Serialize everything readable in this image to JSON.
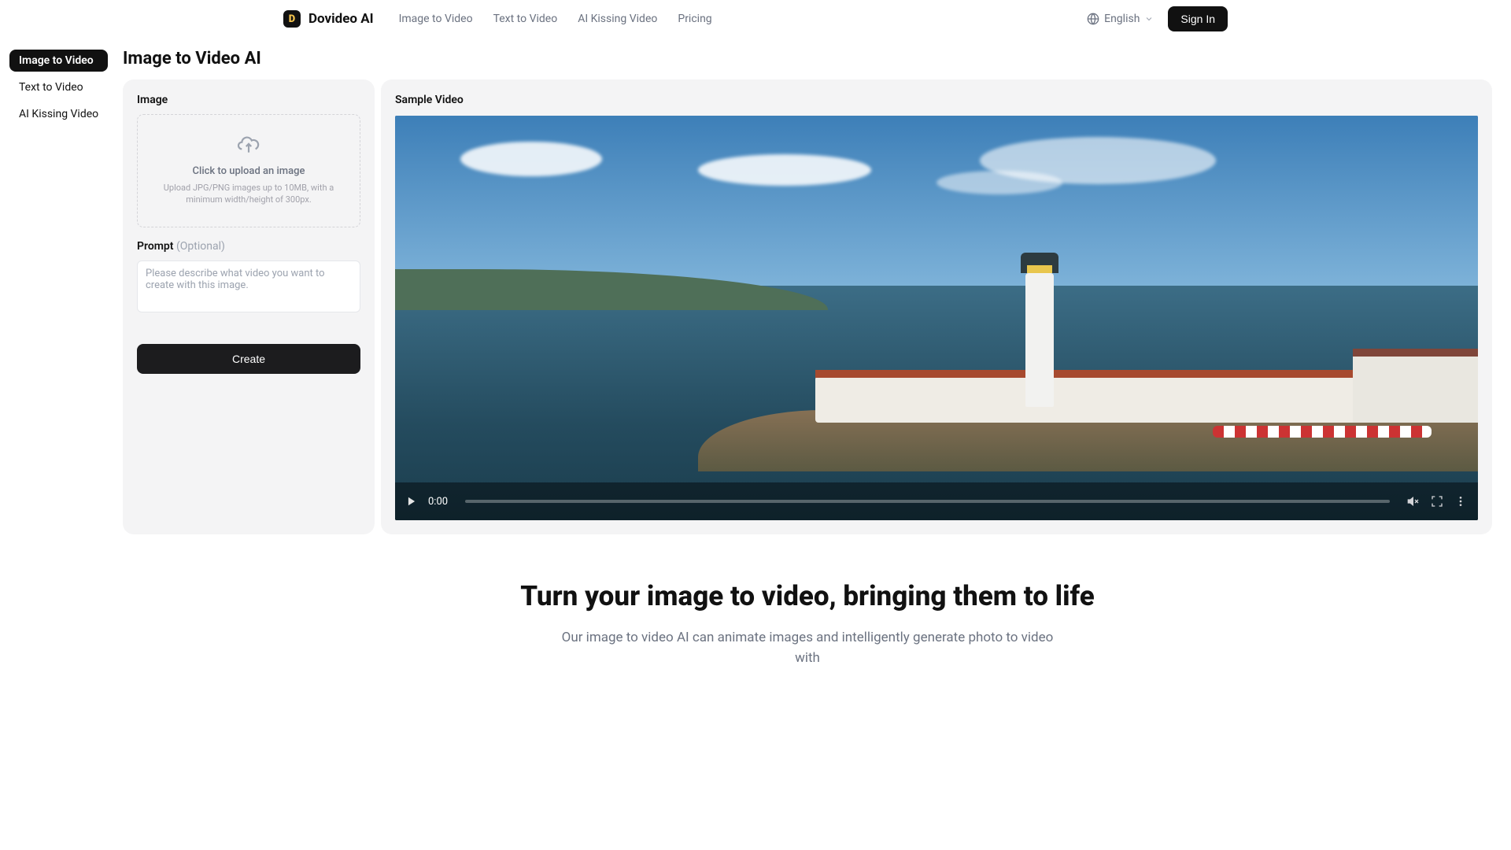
{
  "header": {
    "brand": "Dovideo AI",
    "nav": {
      "imageToVideo": "Image to Video",
      "textToVideo": "Text to Video",
      "aiKissing": "AI Kissing Video",
      "pricing": "Pricing"
    },
    "language": "English",
    "signIn": "Sign In"
  },
  "sidebar": {
    "items": [
      {
        "label": "Image to Video",
        "active": true
      },
      {
        "label": "Text to Video",
        "active": false
      },
      {
        "label": "AI Kissing Video",
        "active": false
      }
    ]
  },
  "page": {
    "title": "Image to Video AI"
  },
  "form": {
    "imageLabel": "Image",
    "uploadMain": "Click to upload an image",
    "uploadSub": "Upload JPG/PNG images up to 10MB, with a minimum width/height of 300px.",
    "promptLabel": "Prompt",
    "promptOptional": "(Optional)",
    "promptPlaceholder": "Please describe what video you want to create with this image.",
    "createButton": "Create"
  },
  "sample": {
    "label": "Sample Video",
    "time": "0:00"
  },
  "hero": {
    "title": "Turn your image to video, bringing them to life",
    "sub": "Our image to video AI can animate images and intelligently generate photo to video with"
  }
}
